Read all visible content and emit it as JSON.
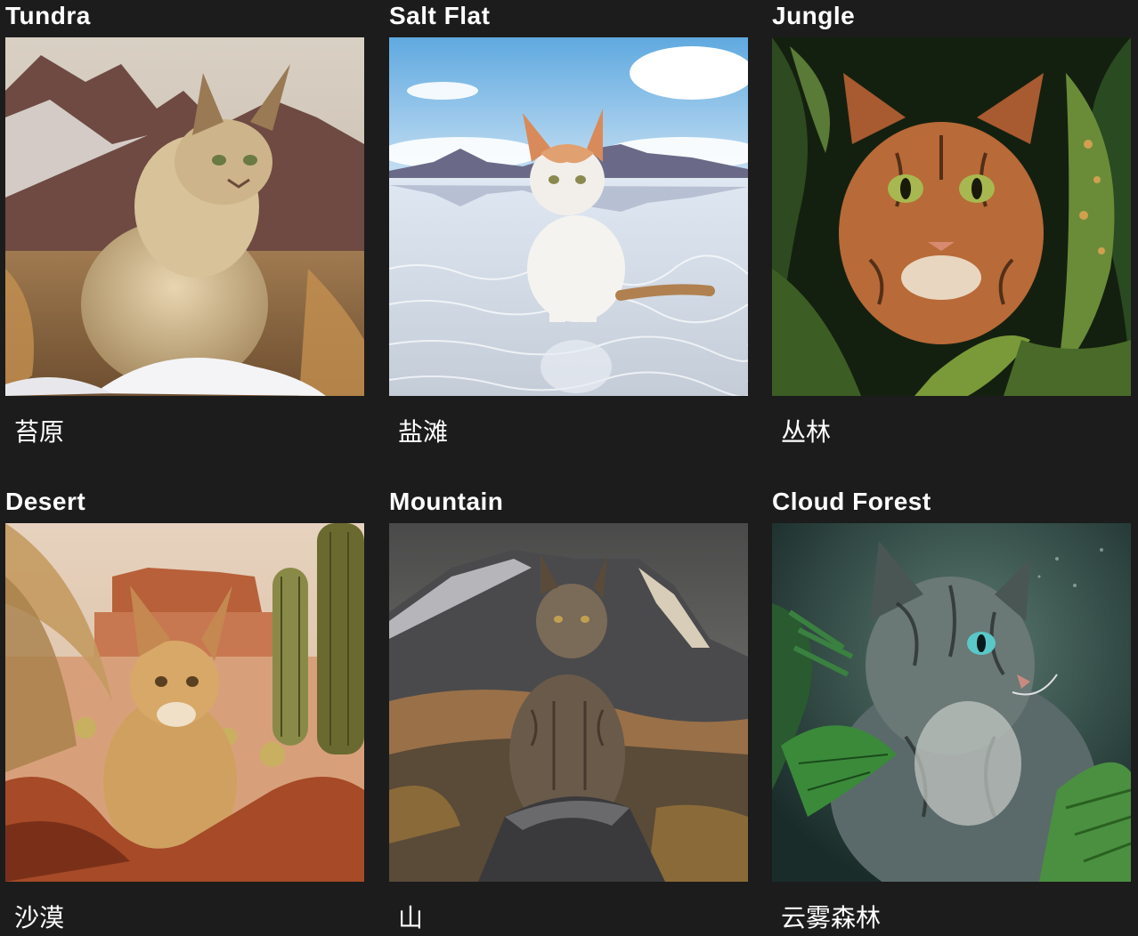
{
  "gallery": {
    "items": [
      {
        "title": "Tundra",
        "caption": "苔原",
        "image": "lynx-cat-in-snowy-tundra"
      },
      {
        "title": "Salt Flat",
        "caption": "盐滩",
        "image": "white-orange-cat-on-salt-flat"
      },
      {
        "title": "Jungle",
        "caption": "丛林",
        "image": "spotted-cat-in-jungle-leaves"
      },
      {
        "title": "Desert",
        "caption": "沙漠",
        "image": "desert-cat-with-cacti"
      },
      {
        "title": "Mountain",
        "caption": "山",
        "image": "lynx-on-mountain-rock"
      },
      {
        "title": "Cloud Forest",
        "caption": "云雾森林",
        "image": "longhair-cat-in-cloud-forest"
      }
    ]
  },
  "colors": {
    "background": "#1c1c1c",
    "text": "#ffffff"
  }
}
